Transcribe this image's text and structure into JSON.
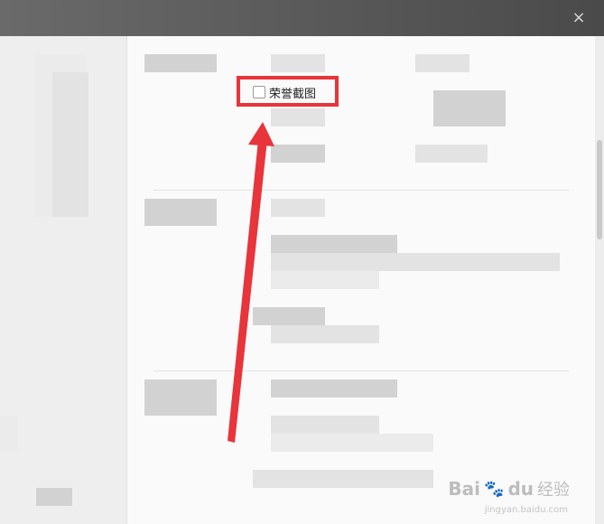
{
  "window": {
    "close_glyph": "×",
    "titlebar_color": "#555555"
  },
  "settings": {
    "honor_screenshot_label": "荣誉截图",
    "honor_screenshot_checked": false
  },
  "annotation": {
    "highlight_color": "#e8343b",
    "arrow_color": "#e8343b"
  },
  "watermark": {
    "logo_text": "Bai",
    "logo_text2": "du",
    "name": "经验",
    "url": "jingyan.baidu.com"
  }
}
